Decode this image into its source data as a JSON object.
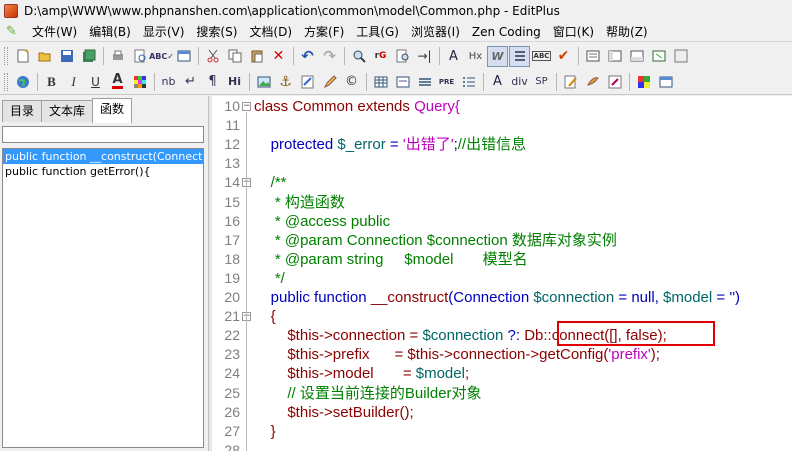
{
  "window": {
    "title": "D:\\amp\\WWW\\www.phpnanshen.com\\application\\common\\model\\Common.php - EditPlus"
  },
  "menu": [
    {
      "label": "文件(W)"
    },
    {
      "label": "编辑(B)"
    },
    {
      "label": "显示(V)"
    },
    {
      "label": "搜索(S)"
    },
    {
      "label": "文档(D)"
    },
    {
      "label": "方案(F)"
    },
    {
      "label": "工具(G)"
    },
    {
      "label": "浏览器(I)"
    },
    {
      "label": "Zen Coding"
    },
    {
      "label": "窗口(K)"
    },
    {
      "label": "帮助(Z)"
    }
  ],
  "toolbar2": {
    "bold": "B",
    "italic": "I",
    "underline": "U",
    "font_color": "A",
    "nbsp": "nb",
    "newline": "↵",
    "paragraph": "¶",
    "heading": "Hi",
    "pre": "PRE",
    "div": "div",
    "span": "SP"
  },
  "toolbar1": {
    "font_size": "A",
    "hx": "Hx",
    "word_wrap": "W",
    "abc": "ABC"
  },
  "left_panel": {
    "tabs": [
      {
        "label": "目录"
      },
      {
        "label": "文本库"
      },
      {
        "label": "函数"
      }
    ],
    "functions": [
      {
        "label": "public function __construct(Connection $c"
      },
      {
        "label": "public function getError(){"
      }
    ]
  },
  "editor": {
    "lines": [
      {
        "num": "10",
        "fold": "⊟",
        "tokens": [
          {
            "t": "class Common extends ",
            "c": "cls"
          },
          {
            "t": "Query{",
            "c": "str"
          }
        ]
      },
      {
        "num": "11",
        "fold": "",
        "tokens": []
      },
      {
        "num": "12",
        "fold": "",
        "tokens": [
          {
            "t": "    protected ",
            "c": "kw"
          },
          {
            "t": "$_error",
            "c": "var"
          },
          {
            "t": " = ",
            "c": "kw"
          },
          {
            "t": "'出错了'",
            "c": "str"
          },
          {
            "t": ";",
            "c": "kw"
          },
          {
            "t": "//出错信息",
            "c": "cmt"
          }
        ]
      },
      {
        "num": "13",
        "fold": "",
        "tokens": []
      },
      {
        "num": "14",
        "fold": "⊟",
        "tokens": [
          {
            "t": "    /**",
            "c": "cmt"
          }
        ]
      },
      {
        "num": "15",
        "fold": "",
        "tokens": [
          {
            "t": "     * 构造函数",
            "c": "cmt"
          }
        ]
      },
      {
        "num": "16",
        "fold": "",
        "tokens": [
          {
            "t": "     * @access public",
            "c": "cmt"
          }
        ]
      },
      {
        "num": "17",
        "fold": "",
        "tokens": [
          {
            "t": "     * @param Connection $connection 数据库对象实例",
            "c": "cmt"
          }
        ]
      },
      {
        "num": "18",
        "fold": "",
        "tokens": [
          {
            "t": "     * @param string     $model       模型名",
            "c": "cmt"
          }
        ]
      },
      {
        "num": "19",
        "fold": "",
        "tokens": [
          {
            "t": "     */",
            "c": "cmt"
          }
        ]
      },
      {
        "num": "20",
        "fold": "",
        "tokens": [
          {
            "t": "    public function ",
            "c": "kw"
          },
          {
            "t": "__construct",
            "c": "cls"
          },
          {
            "t": "(Connection ",
            "c": "kw"
          },
          {
            "t": "$connection",
            "c": "var"
          },
          {
            "t": " = null, ",
            "c": "kw"
          },
          {
            "t": "$model",
            "c": "var"
          },
          {
            "t": " = '')",
            "c": "kw"
          }
        ]
      },
      {
        "num": "21",
        "fold": "⊟",
        "tokens": [
          {
            "t": "    {",
            "c": "cls"
          }
        ]
      },
      {
        "num": "22",
        "fold": "",
        "tokens": [
          {
            "t": "        ",
            "c": "kw"
          },
          {
            "t": "$this",
            "c": "cls"
          },
          {
            "t": "->connection = ",
            "c": "cls"
          },
          {
            "t": "$connection",
            "c": "var"
          },
          {
            "t": " ?: ",
            "c": "kw"
          },
          {
            "t": "Db::connect([], false);",
            "c": "cls"
          }
        ]
      },
      {
        "num": "23",
        "fold": "",
        "tokens": [
          {
            "t": "        ",
            "c": "kw"
          },
          {
            "t": "$this",
            "c": "cls"
          },
          {
            "t": "->prefix      = ",
            "c": "cls"
          },
          {
            "t": "$this",
            "c": "cls"
          },
          {
            "t": "->connection->getConfig(",
            "c": "cls"
          },
          {
            "t": "'prefix'",
            "c": "str"
          },
          {
            "t": ");",
            "c": "cls"
          }
        ]
      },
      {
        "num": "24",
        "fold": "",
        "tokens": [
          {
            "t": "        ",
            "c": "kw"
          },
          {
            "t": "$this",
            "c": "cls"
          },
          {
            "t": "->model       = ",
            "c": "cls"
          },
          {
            "t": "$model",
            "c": "var"
          },
          {
            "t": ";",
            "c": "cls"
          }
        ]
      },
      {
        "num": "25",
        "fold": "",
        "tokens": [
          {
            "t": "        // 设置当前连接的Builder对象",
            "c": "cmt"
          }
        ]
      },
      {
        "num": "26",
        "fold": "",
        "tokens": [
          {
            "t": "        ",
            "c": "kw"
          },
          {
            "t": "$this",
            "c": "cls"
          },
          {
            "t": "->setBuilder();",
            "c": "cls"
          }
        ]
      },
      {
        "num": "27",
        "fold": "",
        "tokens": [
          {
            "t": "    }",
            "c": "cls"
          }
        ]
      },
      {
        "num": "28",
        "fold": "",
        "tokens": []
      }
    ]
  },
  "colors": {
    "selection": "#3399ff",
    "highlight_box": "#e00000",
    "keyword": "#0000c0",
    "string": "#c000c0",
    "comment": "#008000",
    "variable": "#006666"
  }
}
